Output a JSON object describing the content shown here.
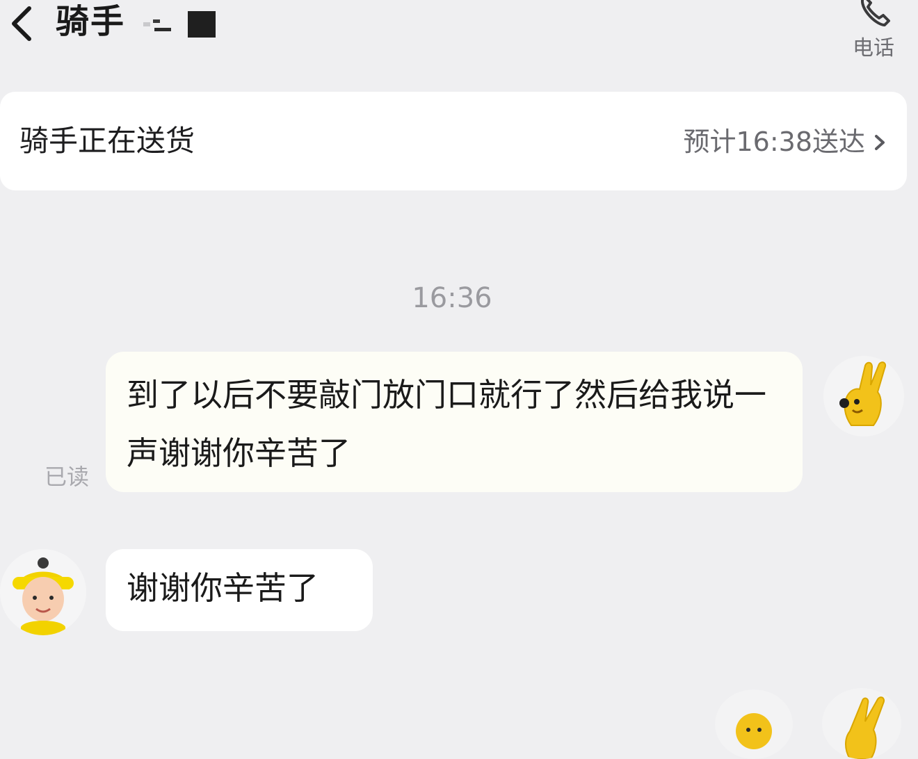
{
  "header": {
    "back_icon": "chevron-left-icon",
    "title": "骑手",
    "call_icon": "phone-icon",
    "call_label": "电话"
  },
  "status_card": {
    "status": "骑手正在送货",
    "eta": "预计16:38送达",
    "chevron_icon": "chevron-right-icon"
  },
  "chat": {
    "timestamp": "16:36",
    "messages": [
      {
        "side": "outgoing",
        "text": "到了以后不要敲门放门口就行了然后给我说一声谢谢你辛苦了",
        "read_label": "已读"
      },
      {
        "side": "incoming",
        "text": "谢谢你辛苦了"
      }
    ]
  },
  "colors": {
    "background": "#efeff1",
    "card": "#ffffff",
    "outgoing_bubble": "#fdfdf6",
    "muted_text": "#9a9a9f",
    "accent_yellow": "#f5c518"
  }
}
